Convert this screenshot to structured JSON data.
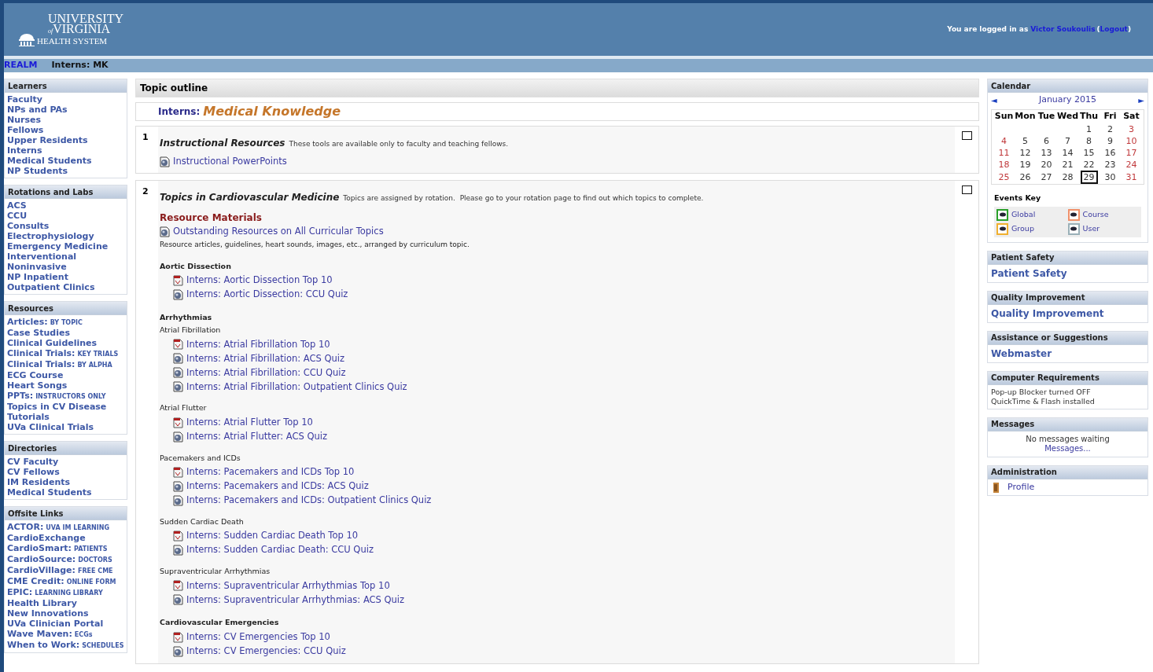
{
  "header": {
    "logo": {
      "line1": "UNIVERSITY",
      "of": "of",
      "line2": "VIRGINIA",
      "line3": "HEALTH SYSTEM"
    },
    "login": {
      "text": "You are logged in as",
      "user": "Victor Soukoulis",
      "open": "(",
      "logout": "Logout",
      "close": ")"
    }
  },
  "breadcrumb": [
    {
      "label": "REALM",
      "kind": "link"
    },
    {
      "label": "Interns: MK",
      "kind": "current"
    }
  ],
  "left_blocks": [
    {
      "title": "Learners",
      "items": [
        {
          "label": "Faculty"
        },
        {
          "label": "NPs and PAs"
        },
        {
          "label": "Nurses"
        },
        {
          "label": "Fellows"
        },
        {
          "label": "Upper Residents"
        },
        {
          "label": "Interns"
        },
        {
          "label": "Medical Students"
        },
        {
          "label": "NP Students"
        }
      ]
    },
    {
      "title": "Rotations and Labs",
      "items": [
        {
          "label": "ACS"
        },
        {
          "label": "CCU"
        },
        {
          "label": "Consults"
        },
        {
          "label": "Electrophysiology"
        },
        {
          "label": "Emergency Medicine"
        },
        {
          "label": "Interventional"
        },
        {
          "label": "Noninvasive"
        },
        {
          "label": "NP Inpatient"
        },
        {
          "label": "Outpatient Clinics"
        }
      ]
    },
    {
      "title": "Resources",
      "items": [
        {
          "label": "Articles:",
          "note": "BY TOPIC"
        },
        {
          "label": "Case Studies"
        },
        {
          "label": "Clinical Guidelines"
        },
        {
          "label": "Clinical Trials:",
          "note": "KEY TRIALS"
        },
        {
          "label": "Clinical Trials:",
          "note": "BY ALPHA"
        },
        {
          "label": "ECG Course"
        },
        {
          "label": "Heart Songs"
        },
        {
          "label": "PPTs:",
          "note": "INSTRUCTORS ONLY"
        },
        {
          "label": "Topics in CV Disease"
        },
        {
          "label": "Tutorials"
        },
        {
          "label": "UVa Clinical Trials"
        }
      ]
    },
    {
      "title": "Directories",
      "items": [
        {
          "label": "CV Faculty"
        },
        {
          "label": "CV Fellows"
        },
        {
          "label": "IM Residents"
        },
        {
          "label": "Medical Students"
        }
      ]
    },
    {
      "title": "Offsite Links",
      "items": [
        {
          "label": "ACTOR:",
          "note": "UVA IM LEARNING"
        },
        {
          "label": "CardioExchange"
        },
        {
          "label": "CardioSmart:",
          "note": "PATIENTS"
        },
        {
          "label": "CardioSource:",
          "note": "DOCTORS"
        },
        {
          "label": "CardioVillage:",
          "note": "FREE CME"
        },
        {
          "label": "CME Credit:",
          "note": "ONLINE FORM"
        },
        {
          "label": "EPIC:",
          "note": "LEARNING LIBRARY"
        },
        {
          "label": "Health Library"
        },
        {
          "label": "New Innovations"
        },
        {
          "label": "UVa Clinician Portal"
        },
        {
          "label": "Wave Maven:",
          "note": "ECGs"
        },
        {
          "label": "When to Work:",
          "note": "SCHEDULES"
        }
      ]
    }
  ],
  "main": {
    "title": "Topic outline",
    "course_prefix": "Interns:",
    "course_name": "Medical Knowledge",
    "sections": [
      {
        "number": "1",
        "title": "Instructional Resources",
        "note": "These tools are available only to faculty and teaching fellows.",
        "checked": false,
        "blocks": [
          {
            "kind": "link",
            "text": "Instructional PowerPoints"
          }
        ]
      },
      {
        "number": "2",
        "title": "Topics in Cardiovascular Medicine",
        "note": "Topics are assigned by rotation.  Please go to your rotation page to find out which topics to complete.",
        "checked": false,
        "blocks": [
          {
            "kind": "resource-heading",
            "text": "Resource Materials"
          },
          {
            "kind": "link",
            "text": "Outstanding Resources on All Curricular Topics"
          },
          {
            "kind": "description",
            "text": "Resource articles, guidelines, heart sounds, images, etc., arranged by curriculum topic."
          },
          {
            "kind": "topic",
            "text": "Aortic Dissection"
          },
          {
            "kind": "pdf-item",
            "text": "Interns: Aortic Dissection Top 10"
          },
          {
            "kind": "quiz-item",
            "text": "Interns: Aortic Dissection: CCU Quiz"
          },
          {
            "kind": "topic",
            "text": "Arrhythmias"
          },
          {
            "kind": "subtopic",
            "text": "Atrial Fibrillation"
          },
          {
            "kind": "pdf-item",
            "text": "Interns: Atrial Fibrillation Top 10"
          },
          {
            "kind": "quiz-item",
            "text": "Interns: Atrial Fibrillation: ACS Quiz"
          },
          {
            "kind": "quiz-item",
            "text": "Interns: Atrial Fibrillation: CCU Quiz"
          },
          {
            "kind": "quiz-item",
            "text": "Interns: Atrial Fibrillation: Outpatient Clinics Quiz"
          },
          {
            "kind": "subtopic",
            "text": "Atrial Flutter"
          },
          {
            "kind": "pdf-item",
            "text": "Interns: Atrial Flutter Top 10"
          },
          {
            "kind": "quiz-item",
            "text": "Interns: Atrial Flutter: ACS Quiz"
          },
          {
            "kind": "subtopic",
            "text": "Pacemakers and ICDs"
          },
          {
            "kind": "pdf-item",
            "text": "Interns: Pacemakers and ICDs Top 10"
          },
          {
            "kind": "quiz-item",
            "text": "Interns: Pacemakers and ICDs: ACS Quiz"
          },
          {
            "kind": "quiz-item",
            "text": "Interns: Pacemakers and ICDs: Outpatient Clinics Quiz"
          },
          {
            "kind": "subtopic",
            "text": "Sudden Cardiac Death"
          },
          {
            "kind": "pdf-item",
            "text": "Interns: Sudden Cardiac Death Top 10"
          },
          {
            "kind": "quiz-item",
            "text": "Interns: Sudden Cardiac Death: CCU Quiz"
          },
          {
            "kind": "subtopic",
            "text": "Supraventricular Arrhythmias"
          },
          {
            "kind": "pdf-item",
            "text": "Interns: Supraventricular Arrhythmias Top 10"
          },
          {
            "kind": "quiz-item",
            "text": "Interns: Supraventricular Arrhythmias: ACS Quiz"
          },
          {
            "kind": "topic",
            "text": "Cardiovascular Emergencies"
          },
          {
            "kind": "pdf-item",
            "text": "Interns: CV Emergencies Top 10"
          },
          {
            "kind": "quiz-item",
            "text": "Interns: CV Emergencies: CCU Quiz"
          }
        ]
      }
    ]
  },
  "calendar": {
    "title": "Calendar",
    "prev": "◄",
    "month": "January 2015",
    "next": "►",
    "weekdays": [
      "Sun",
      "Mon",
      "Tue",
      "Wed",
      "Thu",
      "Fri",
      "Sat"
    ],
    "weeks": [
      [
        {
          "kind": "blank"
        },
        {
          "kind": "blank"
        },
        {
          "kind": "blank"
        },
        {
          "kind": "blank"
        },
        {
          "kind": "day",
          "day": "1",
          "today": false
        },
        {
          "kind": "day",
          "day": "2",
          "today": false
        },
        {
          "kind": "day",
          "day": "3",
          "today": false
        }
      ],
      [
        {
          "kind": "day",
          "day": "4",
          "today": false
        },
        {
          "kind": "day",
          "day": "5",
          "today": false
        },
        {
          "kind": "day",
          "day": "6",
          "today": false
        },
        {
          "kind": "day",
          "day": "7",
          "today": false
        },
        {
          "kind": "day",
          "day": "8",
          "today": false
        },
        {
          "kind": "day",
          "day": "9",
          "today": false
        },
        {
          "kind": "day",
          "day": "10",
          "today": false
        }
      ],
      [
        {
          "kind": "day",
          "day": "11",
          "today": false
        },
        {
          "kind": "day",
          "day": "12",
          "today": false
        },
        {
          "kind": "day",
          "day": "13",
          "today": false
        },
        {
          "kind": "day",
          "day": "14",
          "today": false
        },
        {
          "kind": "day",
          "day": "15",
          "today": false
        },
        {
          "kind": "day",
          "day": "16",
          "today": false
        },
        {
          "kind": "day",
          "day": "17",
          "today": false
        }
      ],
      [
        {
          "kind": "day",
          "day": "18",
          "today": false
        },
        {
          "kind": "day",
          "day": "19",
          "today": false
        },
        {
          "kind": "day",
          "day": "20",
          "today": false
        },
        {
          "kind": "day",
          "day": "21",
          "today": false
        },
        {
          "kind": "day",
          "day": "22",
          "today": false
        },
        {
          "kind": "day",
          "day": "23",
          "today": false
        },
        {
          "kind": "day",
          "day": "24",
          "today": false
        }
      ],
      [
        {
          "kind": "day",
          "day": "25",
          "today": false
        },
        {
          "kind": "day",
          "day": "26",
          "today": false
        },
        {
          "kind": "day",
          "day": "27",
          "today": false
        },
        {
          "kind": "day",
          "day": "28",
          "today": false
        },
        {
          "kind": "day",
          "day": "29",
          "today": true
        },
        {
          "kind": "day",
          "day": "30",
          "today": false
        },
        {
          "kind": "day",
          "day": "31",
          "today": false
        }
      ]
    ],
    "events_key_title": "Events Key",
    "events_key": [
      {
        "label": "Global",
        "color": "#2aa02a"
      },
      {
        "label": "Course",
        "color": "#f0906a"
      },
      {
        "label": "Group",
        "color": "#f0b030"
      },
      {
        "label": "User",
        "color": "#9ab0b8"
      }
    ]
  },
  "right_blocks": [
    {
      "kind": "link",
      "title": "Patient Safety",
      "lines": [
        "Patient Safety"
      ]
    },
    {
      "kind": "link",
      "title": "Quality Improvement",
      "lines": [
        "Quality Improvement"
      ]
    },
    {
      "kind": "link",
      "title": "Assistance or Suggestions",
      "lines": [
        "Webmaster"
      ]
    },
    {
      "kind": "text",
      "title": "Computer Requirements",
      "lines": [
        "Pop-up Blocker turned OFF",
        "QuickTime & Flash installed"
      ]
    },
    {
      "kind": "messages",
      "title": "Messages",
      "lines": [
        "No messages waiting",
        "Messages..."
      ]
    },
    {
      "kind": "admin",
      "title": "Administration",
      "lines": [
        "Profile"
      ]
    }
  ]
}
